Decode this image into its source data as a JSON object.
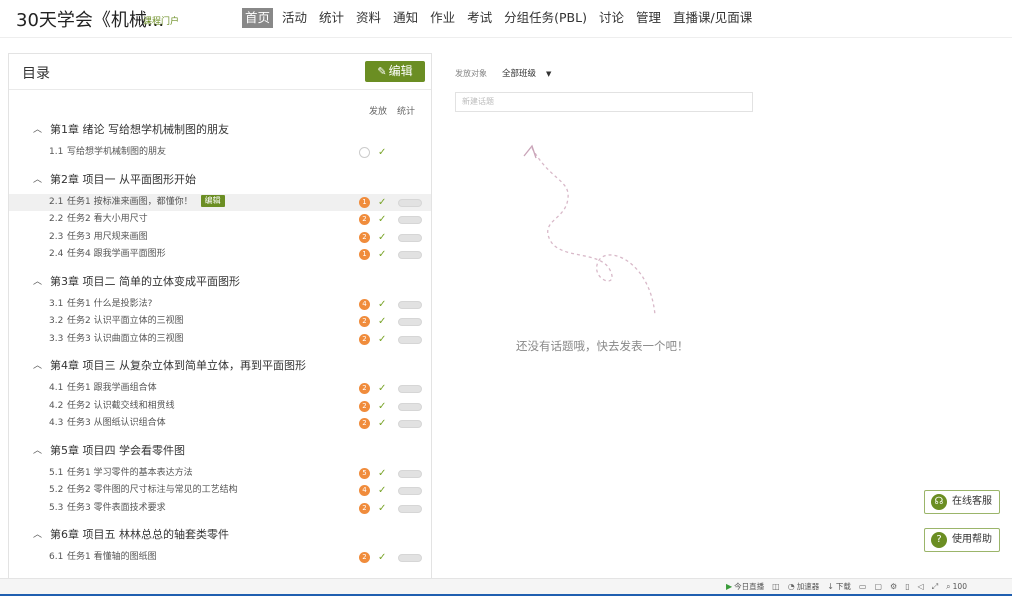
{
  "header": {
    "course_title": "30天学会《机械...",
    "course_portal": "课程门户",
    "nav": [
      "首页",
      "活动",
      "统计",
      "资料",
      "通知",
      "作业",
      "考试",
      "分组任务(PBL)",
      "讨论",
      "管理",
      "直播课/见面课"
    ]
  },
  "toc": {
    "title": "目录",
    "edit_label": "编辑",
    "col_publish": "发放",
    "col_stats": "统计",
    "chapters": [
      {
        "title": "第1章 绪论 写给想学机械制图的朋友",
        "lessons": [
          {
            "num": "1.1",
            "title": "写给想学机械制图的朋友",
            "status": ""
          }
        ]
      },
      {
        "title": "第2章 项目一 从平面图形开始",
        "lessons": [
          {
            "num": "2.1",
            "title": "任务1 按标准来画图，都懂你！",
            "status": "1"
          },
          {
            "num": "2.2",
            "title": "任务2 看大小用尺寸",
            "status": "2"
          },
          {
            "num": "2.3",
            "title": "任务3 用尺规来画图",
            "status": "2"
          },
          {
            "num": "2.4",
            "title": "任务4 跟我学画平面图形",
            "status": "1"
          }
        ]
      },
      {
        "title": "第3章 项目二 简单的立体变成平面图形",
        "lessons": [
          {
            "num": "3.1",
            "title": "任务1 什么是投影法?",
            "status": "4"
          },
          {
            "num": "3.2",
            "title": "任务2 认识平面立体的三视图",
            "status": "2"
          },
          {
            "num": "3.3",
            "title": "任务3 认识曲面立体的三视图",
            "status": "2"
          }
        ]
      },
      {
        "title": "第4章 项目三 从复杂立体到简单立体，再到平面图形",
        "lessons": [
          {
            "num": "4.1",
            "title": "任务1 跟我学画组合体",
            "status": "2"
          },
          {
            "num": "4.2",
            "title": "任务2 认识截交线和相贯线",
            "status": "2"
          },
          {
            "num": "4.3",
            "title": "任务3 从图纸认识组合体",
            "status": "2"
          }
        ]
      },
      {
        "title": "第5章 项目四 学会看零件图",
        "lessons": [
          {
            "num": "5.1",
            "title": "任务1 学习零件的基本表达方法",
            "status": "5"
          },
          {
            "num": "5.2",
            "title": "任务2 零件图的尺寸标注与常见的工艺结构",
            "status": "4"
          },
          {
            "num": "5.3",
            "title": "任务3 零件表面技术要求",
            "status": "2"
          }
        ]
      },
      {
        "title": "第6章 项目五 林林总总的轴套类零件",
        "lessons": [
          {
            "num": "6.1",
            "title": "任务1 看懂轴的图纸图",
            "status": "2"
          }
        ]
      }
    ],
    "lesson_edit_badge": "编辑"
  },
  "right": {
    "send_label": "发放对象",
    "send_value": "全部班级",
    "topic_placeholder": "新建话题",
    "empty_text": "还没有话题哦，快去发表一个吧！"
  },
  "float": {
    "service": "在线客服",
    "help": "使用帮助"
  },
  "bottom": [
    "今日直播",
    "加速器",
    "下载",
    "100"
  ]
}
